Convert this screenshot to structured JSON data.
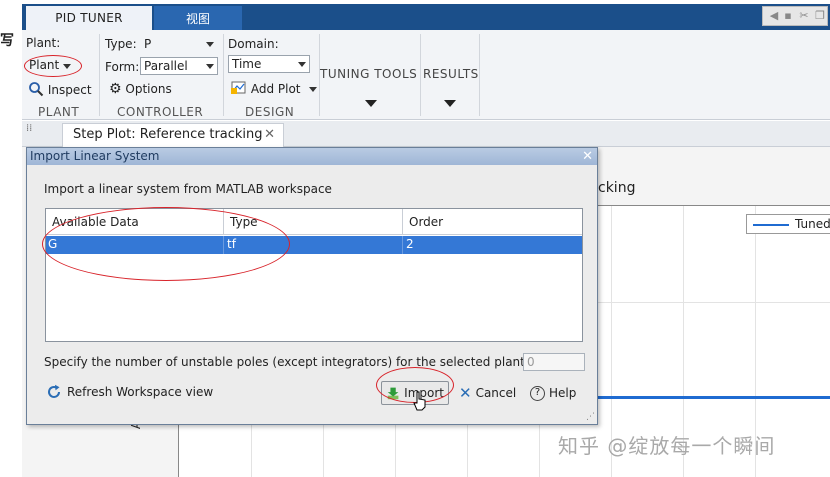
{
  "tabs": {
    "pid_tuner": "PID TUNER",
    "view": "视图"
  },
  "left_edge_glyph": "写",
  "ribbon": {
    "plant": {
      "label": "Plant:",
      "dropdown": "Plant",
      "inspect": "Inspect",
      "group": "PLANT"
    },
    "controller": {
      "type_label": "Type:",
      "type_value": "P",
      "form_label": "Form:",
      "form_value": "Parallel",
      "options": "Options",
      "group": "CONTROLLER"
    },
    "design": {
      "domain_label": "Domain:",
      "domain_value": "Time",
      "add_plot": "Add Plot",
      "group": "DESIGN"
    },
    "tuning_tools": "TUNING TOOLS",
    "results": "RESULTS"
  },
  "document_tab": {
    "title": "Step Plot: Reference tracking",
    "close": "✕"
  },
  "plot": {
    "title_fragment": "cking",
    "legend_entry": "Tuned",
    "ylabel_fragment": "A"
  },
  "dialog": {
    "title": "Import Linear System",
    "close": "✕",
    "heading": "Import a linear system from MATLAB workspace",
    "table": {
      "columns": [
        "Available Data",
        "Type",
        "Order"
      ],
      "rows": [
        {
          "name": "G",
          "type": "tf",
          "order": "2"
        }
      ]
    },
    "unstable_label": "Specify the number of unstable poles (except integrators) for the selected plant:",
    "unstable_value": "0",
    "refresh": "Refresh Workspace view",
    "import": "Import",
    "cancel": "Cancel",
    "help": "Help"
  },
  "watermark": "知乎 @绽放每一个瞬间",
  "colors": {
    "tab_bar": "#1b4f8a",
    "selection": "#3478d6",
    "annotation": "#d8232a",
    "response_line": "#1f6bd1"
  }
}
